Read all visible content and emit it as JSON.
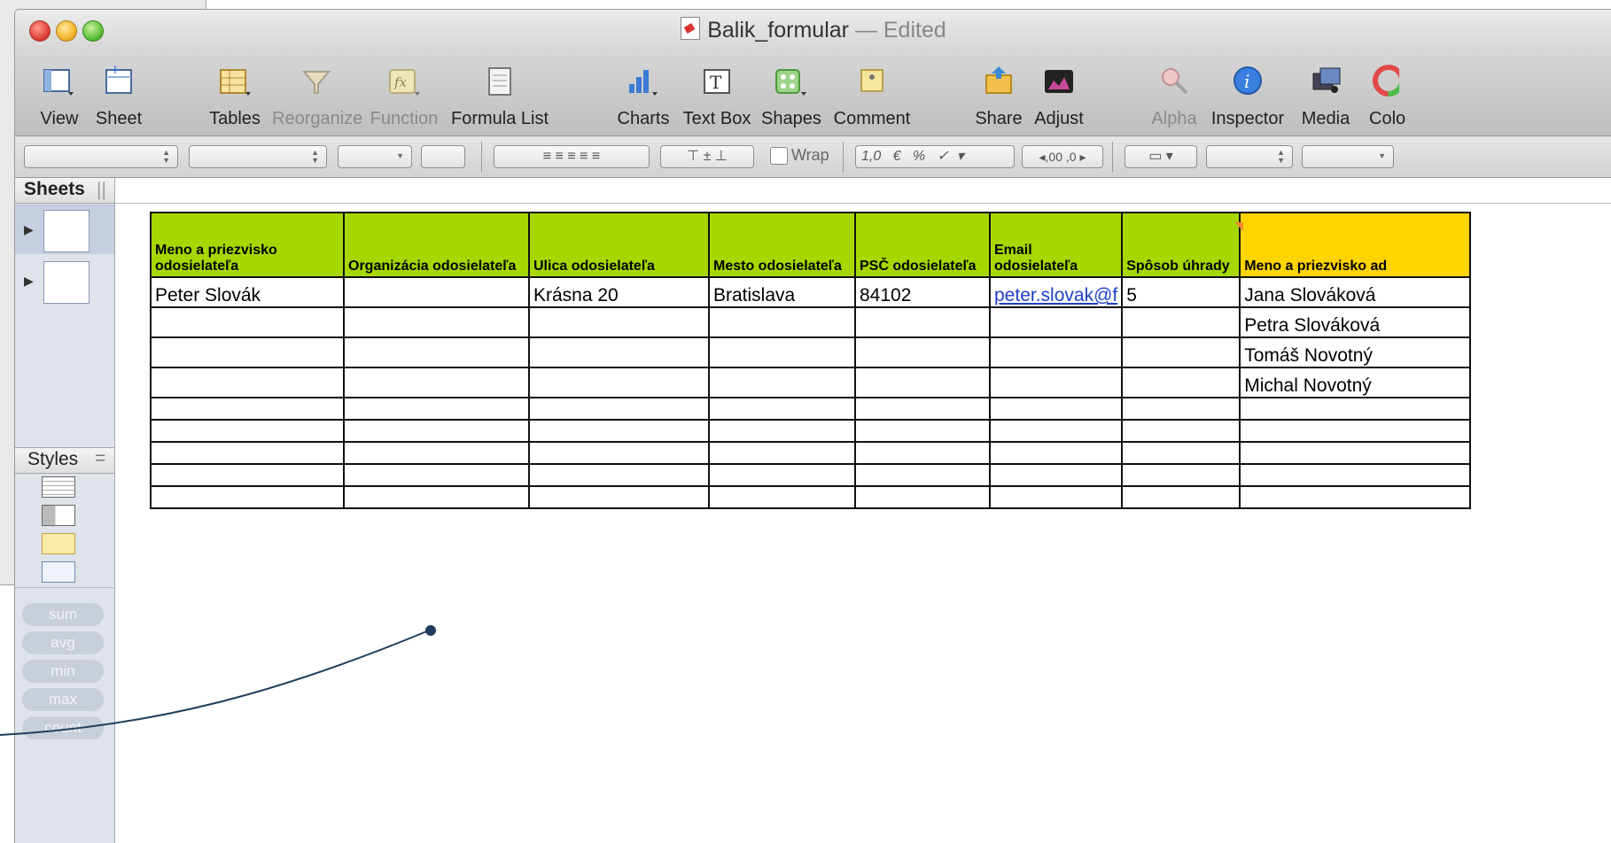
{
  "window": {
    "title": "Balik_formular",
    "title_suffix": "— Edited"
  },
  "toolbar": {
    "view": "View",
    "sheet": "Sheet",
    "tables": "Tables",
    "reorganize": "Reorganize",
    "function": "Function",
    "formula_list": "Formula List",
    "charts": "Charts",
    "text_box": "Text Box",
    "shapes": "Shapes",
    "comment": "Comment",
    "share": "Share",
    "adjust": "Adjust",
    "alpha": "Alpha",
    "inspector": "Inspector",
    "media": "Media",
    "colors": "Colo"
  },
  "formatbar": {
    "wrap": "Wrap",
    "num_format": "1,0",
    "currency": "€",
    "percent": "%",
    "check": "✓",
    "dec_less": "◂,00",
    "dec_more": ",0 ▸"
  },
  "sidebar": {
    "sheets_header": "Sheets",
    "styles_header": "Styles",
    "functions": [
      "sum",
      "avg",
      "min",
      "max",
      "count"
    ]
  },
  "table": {
    "headers": [
      "Meno a priezvisko odosielateľa",
      "Organizácia odosielateľa",
      "Ulica odosielateľa",
      "Mesto odosielateľa",
      "PSČ odosielateľa",
      "Email odosielateľa",
      "Spôsob úhrady",
      "Meno a priezvisko ad"
    ],
    "rows": [
      [
        "Peter Slovák",
        "",
        "Krásna 20",
        "Bratislava",
        "84102",
        "peter.slovak@f",
        "5",
        "Jana Slováková"
      ],
      [
        "",
        "",
        "",
        "",
        "",
        "",
        "",
        "Petra Slováková"
      ],
      [
        "",
        "",
        "",
        "",
        "",
        "",
        "",
        "Tomáš Novotný"
      ],
      [
        "",
        "",
        "",
        "",
        "",
        "",
        "",
        "Michal Novotný"
      ],
      [
        "",
        "",
        "",
        "",
        "",
        "",
        "",
        ""
      ],
      [
        "",
        "",
        "",
        "",
        "",
        "",
        "",
        ""
      ],
      [
        "",
        "",
        "",
        "",
        "",
        "",
        "",
        ""
      ],
      [
        "",
        "",
        "",
        "",
        "",
        "",
        "",
        ""
      ],
      [
        "",
        "",
        "",
        "",
        "",
        "",
        "",
        ""
      ]
    ]
  },
  "colors": {
    "header_green": "#a6d700",
    "header_orange": "#ffd400",
    "annotation_line": "#1f3d5c"
  }
}
